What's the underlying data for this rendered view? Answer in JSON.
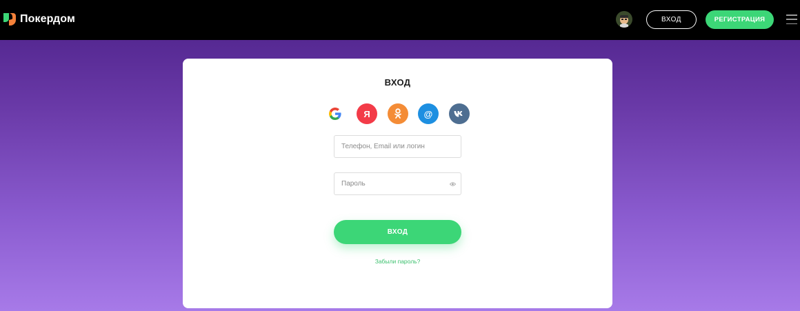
{
  "header": {
    "logo_text": "Покердом",
    "login_label": "ВХОД",
    "register_label": "РЕГИСТРАЦИЯ",
    "menu_icon": "hamburger-icon",
    "avatar_icon": "user-avatar"
  },
  "login_form": {
    "title": "ВХОД",
    "social": [
      {
        "name": "google",
        "glyph": "G",
        "icon": "google-icon",
        "color": "#ffffff"
      },
      {
        "name": "yandex",
        "glyph": "Я",
        "icon": "yandex-icon",
        "color": "#f33b48"
      },
      {
        "name": "odnoklassniki",
        "glyph": "ок",
        "icon": "odnoklassniki-icon",
        "color": "#f48c36"
      },
      {
        "name": "mailru",
        "glyph": "@",
        "icon": "mailru-icon",
        "color": "#1d8fe1"
      },
      {
        "name": "vk",
        "glyph": "vk",
        "icon": "vk-icon",
        "color": "#4e6e91"
      }
    ],
    "login_placeholder": "Телефон, Email или логин",
    "login_value": "",
    "password_placeholder": "Пароль",
    "password_value": "",
    "submit_label": "ВХОД",
    "forgot_label": "Забыли пароль?"
  },
  "colors": {
    "accent": "#3cd677",
    "header_bg": "#000000",
    "page_gradient_top": "#4a1f86",
    "page_gradient_bottom": "#a77ae8"
  }
}
